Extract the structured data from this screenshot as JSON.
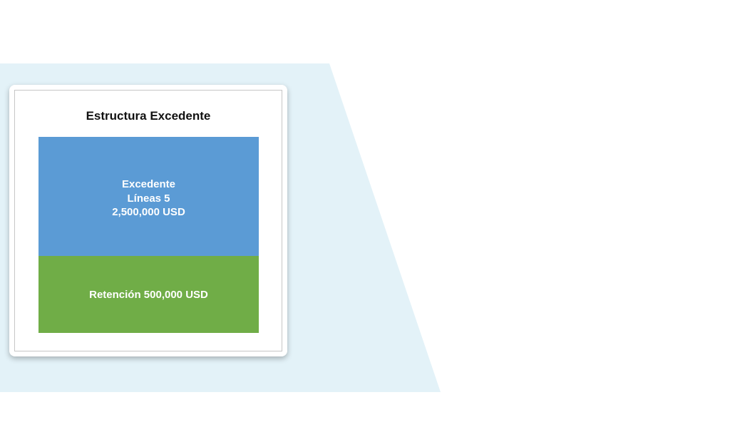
{
  "diagram": {
    "title": "Estructura Excedente",
    "layers": {
      "excess": {
        "name": "Excedente",
        "lines": "Líneas 5",
        "amount": "2,500,000 USD",
        "color": "#5b9bd5"
      },
      "retention": {
        "label": "Retención 500,000 USD",
        "color": "#70ad47"
      }
    }
  },
  "background": {
    "color": "#e3f2f8"
  }
}
